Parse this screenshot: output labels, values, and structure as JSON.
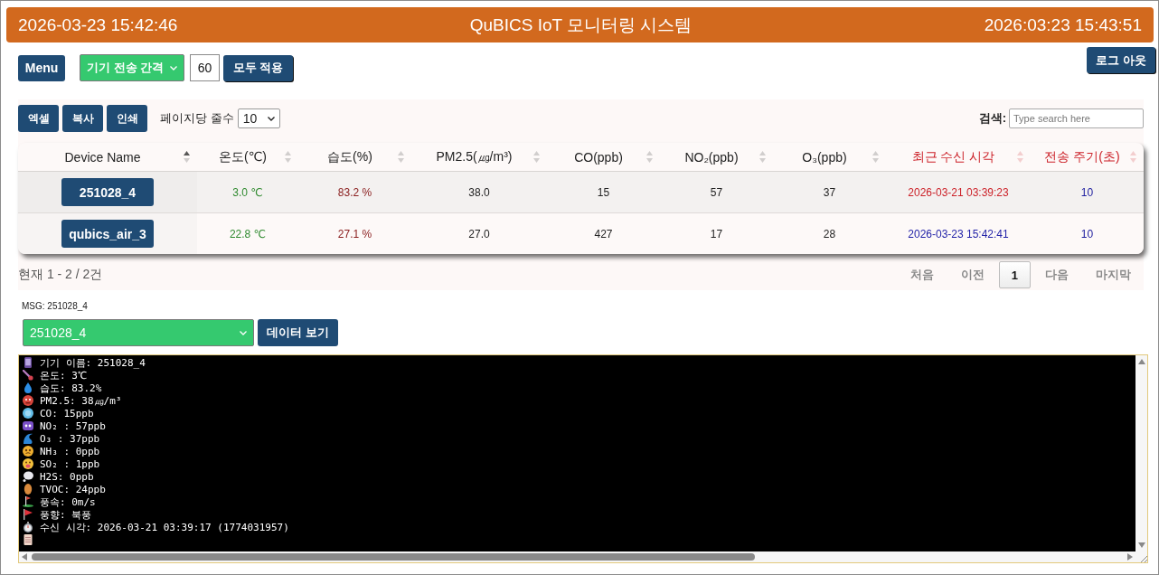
{
  "header": {
    "left_time": "2026-03-23 15:42:46",
    "title": "QuBICS IoT 모니터링 시스템",
    "right_time": "2026:03:23 15:43:51"
  },
  "toolbar": {
    "menu_button": "Menu",
    "interval_select": {
      "value": "기기 전송 간격"
    },
    "interval_input": {
      "value": "60"
    },
    "apply_button": "모두 적용",
    "logout_button": "로그 아웃"
  },
  "table_panel": {
    "export_buttons": [
      "엑셀",
      "복사",
      "인쇄"
    ],
    "page_length_label": "페이지당 줄수",
    "page_length_select": {
      "value": "10"
    },
    "search_label": "검색:",
    "search": {
      "placeholder": "Type search here"
    },
    "table": {
      "columns": [
        {
          "label": "Device Name",
          "kind": "device",
          "sorted": true,
          "color": "#222222"
        },
        {
          "label": "온도(℃)",
          "kind": "temperature",
          "sorted": false,
          "color": "#222222"
        },
        {
          "label": "습도(%)",
          "kind": "humidity",
          "sorted": false,
          "color": "#222222"
        },
        {
          "label": "PM2.5(㎍/m³)",
          "kind": "number",
          "sorted": false,
          "color": "#222222"
        },
        {
          "label": "CO(ppb)",
          "kind": "number",
          "sorted": false,
          "color": "#222222"
        },
        {
          "label": "NO₂(ppb)",
          "kind": "number",
          "sorted": false,
          "color": "#222222"
        },
        {
          "label": "O₃(ppb)",
          "kind": "number",
          "sorted": false,
          "color": "#222222"
        },
        {
          "label": "최근 수신 시각",
          "kind": "received",
          "sorted": false,
          "color": "#cc2229"
        },
        {
          "label": "전송 주기(초)",
          "kind": "period",
          "sorted": false,
          "color": "#cc2229"
        }
      ],
      "rows": [
        {
          "cells": [
            "251028_4",
            "3.0 ℃",
            "83.2 %",
            "38.0",
            "15",
            "57",
            "37",
            "2026-03-21 03:39:23",
            "10"
          ],
          "color": "#cc2229"
        },
        {
          "cells": [
            "qubics_air_3",
            "22.8 ℃",
            "27.1 %",
            "27.0",
            "427",
            "17",
            "28",
            "2026-03-23 15:42:41",
            "10"
          ],
          "color": "#2323a8"
        }
      ]
    },
    "info": "현재 1 - 2 / 2건",
    "pagination": [
      {
        "label": "처음",
        "selected": false,
        "disabled": true
      },
      {
        "label": "이전",
        "selected": false,
        "disabled": true
      },
      {
        "label": "1",
        "selected": true,
        "disabled": false
      },
      {
        "label": "다음",
        "selected": false,
        "disabled": true
      },
      {
        "label": "마지막",
        "selected": false,
        "disabled": true
      }
    ]
  },
  "message_panel": {
    "label": "MSG: 251028_4",
    "device_select": {
      "value": "251028_4"
    },
    "view_button": "데이터 보기"
  },
  "log": {
    "lines": [
      "기기 이름: 251028_4",
      "온도: 3℃",
      "습도: 83.2%",
      "PM2.5: 38㎍/m³",
      "CO: 15ppb",
      "NO₂ : 57ppb",
      "O₃ : 37ppb",
      "NH₃ : 0ppb",
      "SO₂ : 1ppb",
      "H2S: 0ppb",
      "TVOC: 24ppb",
      "풍속: 0m/s",
      "풍향: 북풍",
      "수신 시각: 2026-03-21 03:39:17 (1774031957)"
    ]
  }
}
